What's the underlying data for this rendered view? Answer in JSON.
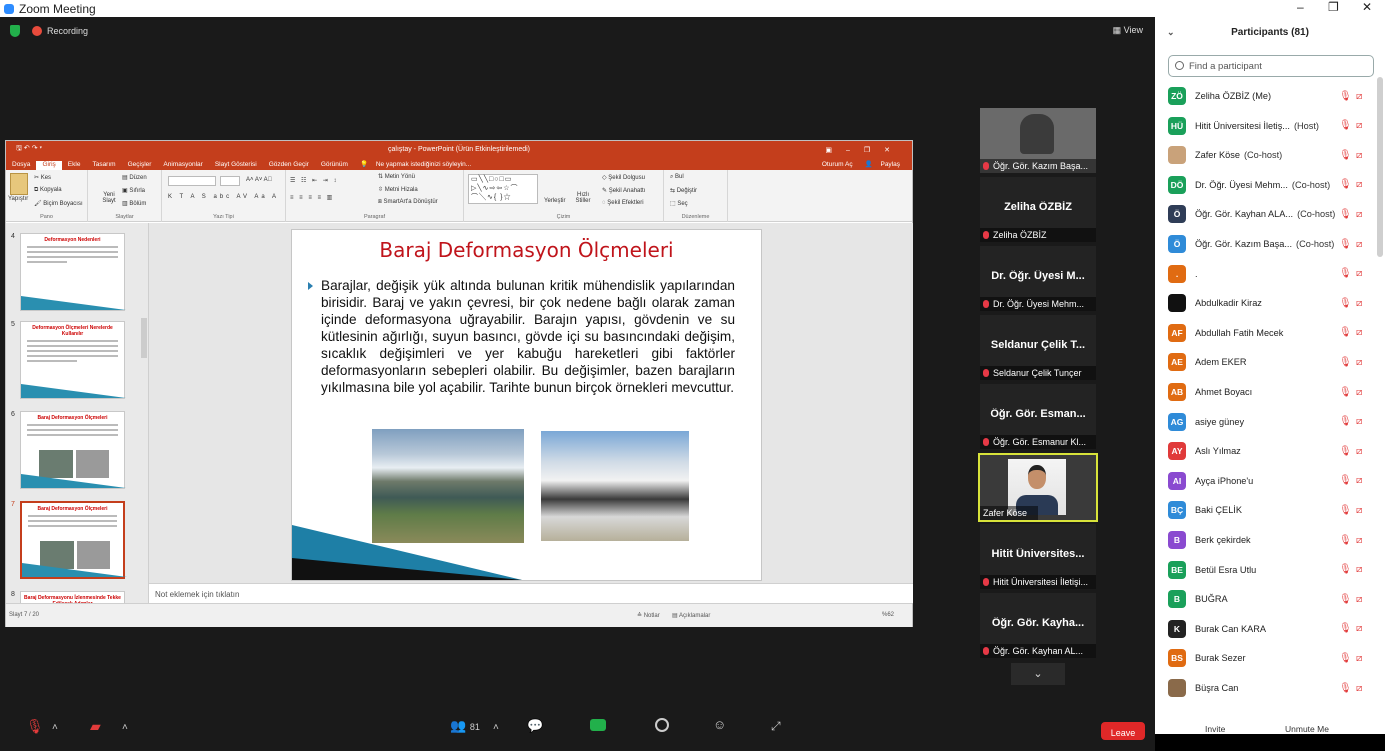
{
  "window": {
    "title": "Zoom Meeting"
  },
  "meeting": {
    "recording": "Recording",
    "view": "View"
  },
  "ppt": {
    "title": "çalıştay - PowerPoint (Ürün Etkinleştirilemedi)",
    "tabs": [
      "Dosya",
      "Giriş",
      "Ekle",
      "Tasarım",
      "Geçişler",
      "Animasyonlar",
      "Slayt Gösterisi",
      "Gözden Geçir",
      "Görünüm"
    ],
    "search": "Ne yapmak istediğinizi söyleyin...",
    "signin": "Oturum Aç",
    "share": "Paylaş",
    "ribbon": {
      "paste": "Yapıştır",
      "cut": "Kes",
      "copy": "Kopyala",
      "format_painter": "Biçim Boyacısı",
      "clipboard": "Pano",
      "new_slide": "Yeni Slayt",
      "layout": "Düzen",
      "reset": "Sıfırla",
      "section": "Bölüm",
      "slides": "Slaytlar",
      "font": "Yazı Tipi",
      "text_direction": "Metin Yönü",
      "align_text": "Metni Hizala",
      "smartart": "SmartArt'a Dönüştür",
      "paragraph": "Paragraf",
      "arrange": "Yerleştir",
      "quick_styles": "Hızlı Stiller",
      "shape_fill": "Şekil Dolgusu",
      "shape_outline": "Şekil Anahattı",
      "shape_effects": "Şekil Efektleri",
      "drawing": "Çizim",
      "find": "Bul",
      "replace": "Değiştir",
      "select": "Seç",
      "editing": "Düzenleme"
    },
    "thumbs": [
      {
        "num": "4",
        "title": "Deformasyon Nedenleri"
      },
      {
        "num": "5",
        "title": "Deformasyon Ölçmeleri Nerelerde Kullanılır"
      },
      {
        "num": "6",
        "title": "Baraj Deformasyon Ölçmeleri"
      },
      {
        "num": "7",
        "title": "Baraj Deformasyon Ölçmeleri"
      },
      {
        "num": "8",
        "title": "Baraj Deformasyonu İzlenmesinde Tekke Edilecek Adımlar"
      }
    ],
    "slide": {
      "title": "Baraj Deformasyon Ölçmeleri",
      "body": "Barajlar, değişik yük altında bulunan kritik mühendislik yapılarından birisidir. Baraj ve yakın çevresi, bir çok nedene bağlı olarak zaman içinde deformasyona uğrayabilir. Barajın yapısı, gövdenin ve su kütlesinin ağırlığı, suyun basıncı, gövde içi su basıncındaki değişim, sıcaklık değişimleri ve yer kabuğu hareketleri gibi faktörler deformasyonların sebepleri olabilir. Bu değişimler, bazen barajların yıkılmasına bile yol açabilir. Tarihte bunun birçok örnekleri mevcuttur."
    },
    "notes": "Not eklemek için tıklatın",
    "status": {
      "slide": "Slayt 7 / 20",
      "notes": "Notlar",
      "comments": "Açıklamalar",
      "zoom": "%62"
    }
  },
  "gallery": [
    {
      "name": "",
      "caption": "Öğr. Gör. Kazım Başa...",
      "video": true
    },
    {
      "name": "Zeliha ÖZBİZ",
      "caption": "Zeliha ÖZBİZ"
    },
    {
      "name": "Dr. Öğr. Üyesi M...",
      "caption": "Dr. Öğr. Üyesi Mehm..."
    },
    {
      "name": "Seldanur Çelik T...",
      "caption": "Seldanur Çelik Tunçer"
    },
    {
      "name": "Öğr. Gör. Esman...",
      "caption": "Öğr. Gör. Esmanur Kl..."
    },
    {
      "name": "",
      "caption": "Zafer Köse",
      "active": true
    },
    {
      "name": "Hitit Üniversites...",
      "caption": "Hitit Üniversitesi İletişi..."
    },
    {
      "name": "Öğr. Gör. Kayha...",
      "caption": "Öğr. Gör. Kayhan AL..."
    }
  ],
  "toolbar": {
    "participants_count": "81",
    "leave": "Leave"
  },
  "panel": {
    "title": "Participants (81)",
    "search_placeholder": "Find a participant",
    "invite": "Invite",
    "unmute": "Unmute Me",
    "participants": [
      {
        "initials": "ZÖ",
        "color": "#1aa05a",
        "name": "Zeliha ÖZBİZ (Me)"
      },
      {
        "initials": "HÜ",
        "color": "#1aa05a",
        "name": "Hitit Üniversitesi İletiş...",
        "role": "(Host)"
      },
      {
        "initials": "",
        "color": "#c9a27a",
        "name": "Zafer Köse",
        "role": "(Co-host)"
      },
      {
        "initials": "DÖ",
        "color": "#1aa05a",
        "name": "Dr. Öğr. Üyesi Mehm...",
        "role": "(Co-host)"
      },
      {
        "initials": "Ö",
        "color": "#2f3d57",
        "name": "Öğr. Gör. Kayhan ALA...",
        "role": "(Co-host)"
      },
      {
        "initials": "Ö",
        "color": "#2f8bd8",
        "name": "Öğr. Gör. Kazım Başa...",
        "role": "(Co-host)"
      },
      {
        "initials": ".",
        "color": "#e06b12",
        "name": "."
      },
      {
        "initials": "",
        "color": "#111111",
        "name": "Abdulkadir Kiraz"
      },
      {
        "initials": "AF",
        "color": "#e06b12",
        "name": "Abdullah Fatih Mecek"
      },
      {
        "initials": "AE",
        "color": "#e06b12",
        "name": "Adem EKER"
      },
      {
        "initials": "AB",
        "color": "#e06b12",
        "name": "Ahmet Boyacı"
      },
      {
        "initials": "AG",
        "color": "#2f8bd8",
        "name": "asiye güney"
      },
      {
        "initials": "AY",
        "color": "#e03a3a",
        "name": "Aslı Yılmaz"
      },
      {
        "initials": "AI",
        "color": "#8a4ad0",
        "name": "Ayça iPhone'u"
      },
      {
        "initials": "BÇ",
        "color": "#2f8bd8",
        "name": "Baki ÇELİK"
      },
      {
        "initials": "B",
        "color": "#8a4ad0",
        "name": "Berk çekirdek"
      },
      {
        "initials": "BE",
        "color": "#1aa05a",
        "name": "Betül Esra Utlu"
      },
      {
        "initials": "B",
        "color": "#1aa05a",
        "name": "BUĞRA"
      },
      {
        "initials": "K",
        "color": "#222222",
        "name": "Burak Can KARA"
      },
      {
        "initials": "BS",
        "color": "#e06b12",
        "name": "Burak Sezer"
      },
      {
        "initials": "",
        "color": "#8a6a4a",
        "name": "Büşra Can"
      }
    ]
  }
}
